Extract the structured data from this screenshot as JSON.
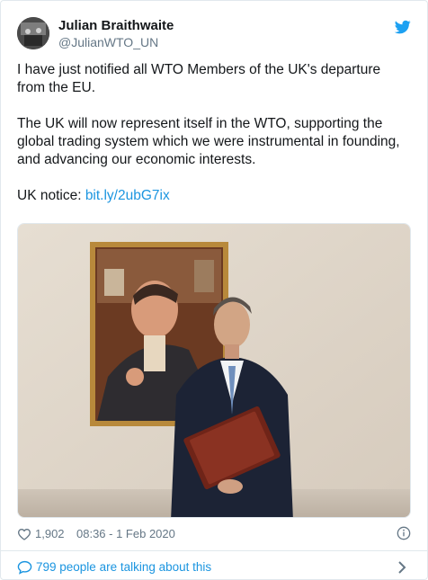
{
  "author": {
    "name": "Julian Braithwaite",
    "handle": "@JulianWTO_UN"
  },
  "tweet": {
    "paragraphs": [
      "I have just notified all WTO Members of the UK's departure from the EU.",
      "The UK will now represent itself in the WTO, supporting the global trading system which we were instrumental in founding, and advancing our economic interests."
    ],
    "notice_prefix": "UK notice: ",
    "notice_link": "bit.ly/2ubG7ix"
  },
  "meta": {
    "likes": "1,902",
    "timestamp": "08:36 - 1 Feb 2020"
  },
  "conversation": {
    "label": "799 people are talking about this"
  },
  "icons": {
    "brand": "twitter-bird-icon",
    "like": "heart-icon",
    "info": "info-icon",
    "reply": "speech-bubble-icon",
    "more": "chevron-right-icon"
  },
  "colors": {
    "link": "#1b95e0",
    "secondary_text": "#657786",
    "divider": "#e1e8ed"
  }
}
